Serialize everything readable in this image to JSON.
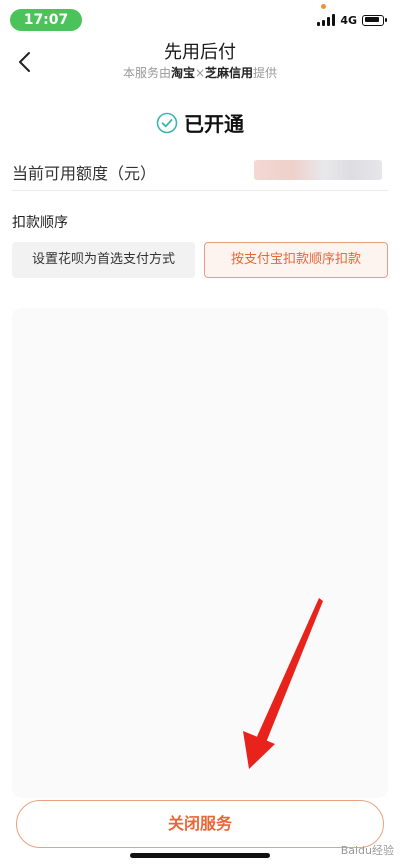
{
  "status_bar": {
    "time": "17:07",
    "network": "4G"
  },
  "header": {
    "title": "先用后付",
    "subtitle_prefix": "本服务由",
    "provider_1": "淘宝",
    "separator": "×",
    "provider_2": "芝麻信用",
    "subtitle_suffix": "提供"
  },
  "status": {
    "label": "已开通"
  },
  "credit": {
    "label": "当前可用额度（元）",
    "value": ""
  },
  "deduct_order": {
    "title": "扣款顺序",
    "option_1": "设置花呗为首选支付方式",
    "option_2": "按支付宝扣款顺序扣款"
  },
  "bottom": {
    "close_button": "关闭服务",
    "watermark": "Baidu经验"
  },
  "colors": {
    "accent": "#e8663a",
    "status_green": "#4bc35a",
    "check_teal": "#3ab6b0",
    "annotation_red": "#e8231c"
  }
}
